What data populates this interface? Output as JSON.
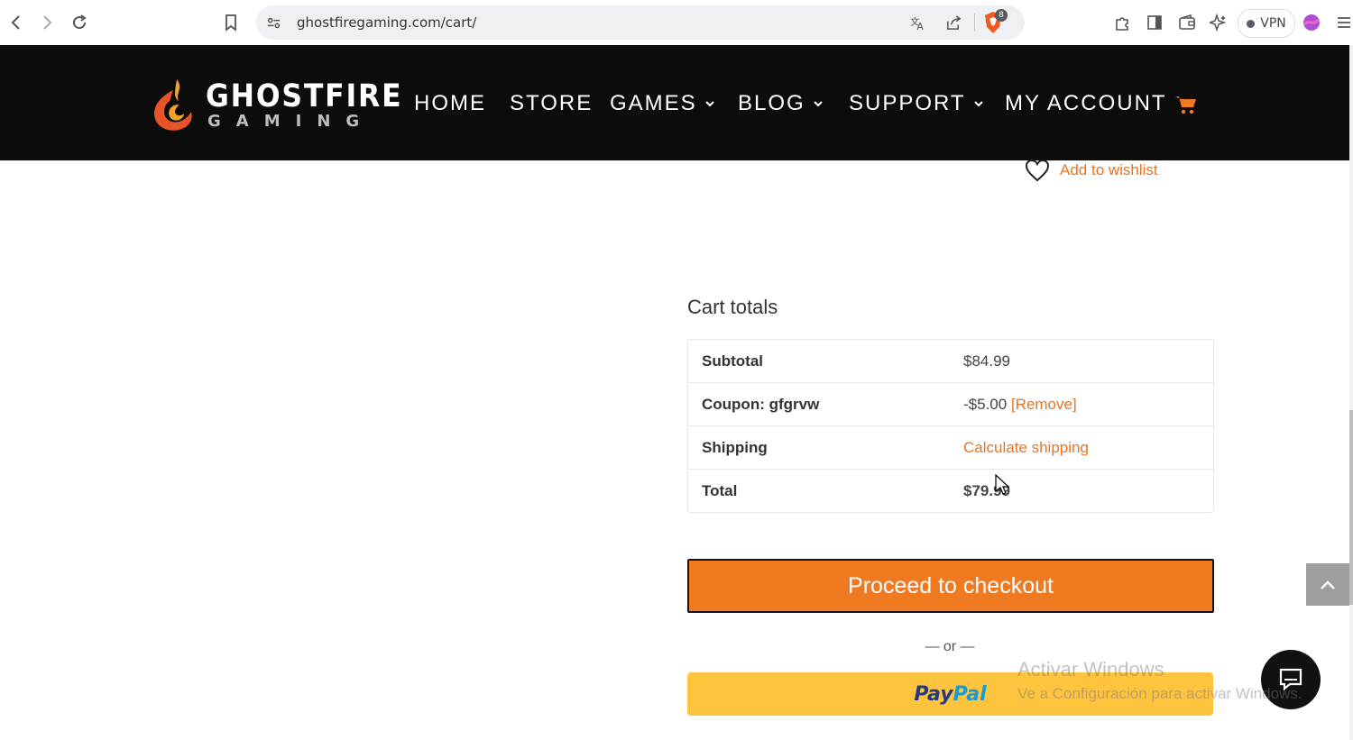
{
  "browser": {
    "url": "ghostfiregaming.com/cart/",
    "brave_badge": "8",
    "vpn_label": "VPN"
  },
  "header": {
    "logo_line1": "GHOSTFIRE",
    "logo_line2": "GAMING",
    "nav": [
      {
        "label": "HOME",
        "has_dropdown": false
      },
      {
        "label": "STORE",
        "has_dropdown": false
      },
      {
        "label": "GAMES",
        "has_dropdown": true
      },
      {
        "label": "BLOG",
        "has_dropdown": true
      },
      {
        "label": "SUPPORT",
        "has_dropdown": true
      },
      {
        "label": "MY ACCOUNT",
        "has_dropdown": false
      }
    ],
    "cart_icon": "shopping-cart-icon",
    "accent_color": "#f07a22"
  },
  "wishlist": {
    "label": "Add to wishlist"
  },
  "cart_totals": {
    "title": "Cart totals",
    "rows": [
      {
        "label": "Subtotal",
        "value": "$84.99"
      },
      {
        "label": "Coupon: gfgrvw",
        "value": "-$5.00",
        "action": "[Remove]"
      },
      {
        "label": "Shipping",
        "value": "Calculate shipping"
      },
      {
        "label": "Total",
        "value": "$79.99"
      }
    ]
  },
  "checkout_button": "Proceed to checkout",
  "or_separator": "— or —",
  "paypal": {
    "part1": "Pay",
    "part2": "Pal"
  },
  "watermark": {
    "line1": "Activar Windows",
    "line2": "Ve a Configuración para activar Windows."
  }
}
